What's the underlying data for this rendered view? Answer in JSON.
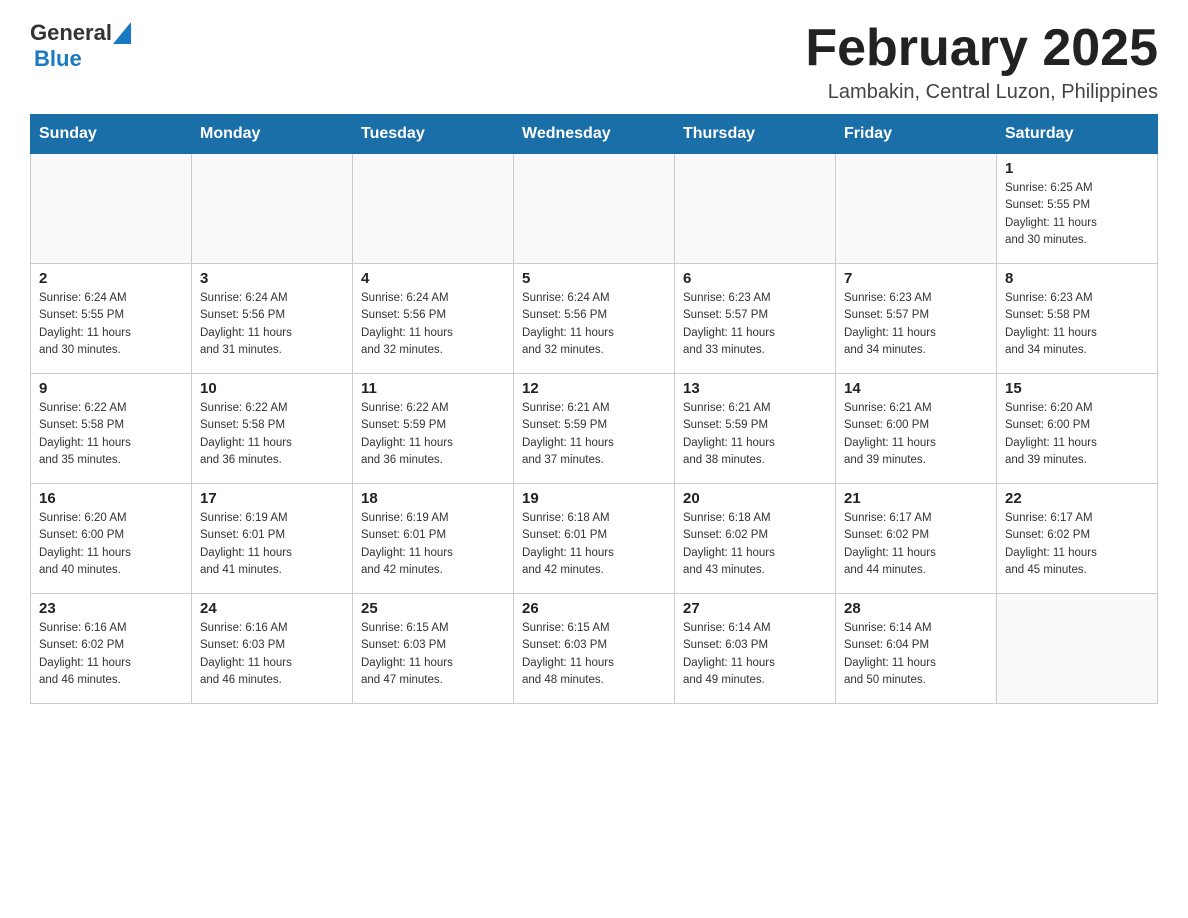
{
  "header": {
    "logo_general": "General",
    "logo_blue": "Blue",
    "month_title": "February 2025",
    "location": "Lambakin, Central Luzon, Philippines"
  },
  "calendar": {
    "days_of_week": [
      "Sunday",
      "Monday",
      "Tuesday",
      "Wednesday",
      "Thursday",
      "Friday",
      "Saturday"
    ],
    "weeks": [
      [
        {
          "day": "",
          "info": ""
        },
        {
          "day": "",
          "info": ""
        },
        {
          "day": "",
          "info": ""
        },
        {
          "day": "",
          "info": ""
        },
        {
          "day": "",
          "info": ""
        },
        {
          "day": "",
          "info": ""
        },
        {
          "day": "1",
          "info": "Sunrise: 6:25 AM\nSunset: 5:55 PM\nDaylight: 11 hours\nand 30 minutes."
        }
      ],
      [
        {
          "day": "2",
          "info": "Sunrise: 6:24 AM\nSunset: 5:55 PM\nDaylight: 11 hours\nand 30 minutes."
        },
        {
          "day": "3",
          "info": "Sunrise: 6:24 AM\nSunset: 5:56 PM\nDaylight: 11 hours\nand 31 minutes."
        },
        {
          "day": "4",
          "info": "Sunrise: 6:24 AM\nSunset: 5:56 PM\nDaylight: 11 hours\nand 32 minutes."
        },
        {
          "day": "5",
          "info": "Sunrise: 6:24 AM\nSunset: 5:56 PM\nDaylight: 11 hours\nand 32 minutes."
        },
        {
          "day": "6",
          "info": "Sunrise: 6:23 AM\nSunset: 5:57 PM\nDaylight: 11 hours\nand 33 minutes."
        },
        {
          "day": "7",
          "info": "Sunrise: 6:23 AM\nSunset: 5:57 PM\nDaylight: 11 hours\nand 34 minutes."
        },
        {
          "day": "8",
          "info": "Sunrise: 6:23 AM\nSunset: 5:58 PM\nDaylight: 11 hours\nand 34 minutes."
        }
      ],
      [
        {
          "day": "9",
          "info": "Sunrise: 6:22 AM\nSunset: 5:58 PM\nDaylight: 11 hours\nand 35 minutes."
        },
        {
          "day": "10",
          "info": "Sunrise: 6:22 AM\nSunset: 5:58 PM\nDaylight: 11 hours\nand 36 minutes."
        },
        {
          "day": "11",
          "info": "Sunrise: 6:22 AM\nSunset: 5:59 PM\nDaylight: 11 hours\nand 36 minutes."
        },
        {
          "day": "12",
          "info": "Sunrise: 6:21 AM\nSunset: 5:59 PM\nDaylight: 11 hours\nand 37 minutes."
        },
        {
          "day": "13",
          "info": "Sunrise: 6:21 AM\nSunset: 5:59 PM\nDaylight: 11 hours\nand 38 minutes."
        },
        {
          "day": "14",
          "info": "Sunrise: 6:21 AM\nSunset: 6:00 PM\nDaylight: 11 hours\nand 39 minutes."
        },
        {
          "day": "15",
          "info": "Sunrise: 6:20 AM\nSunset: 6:00 PM\nDaylight: 11 hours\nand 39 minutes."
        }
      ],
      [
        {
          "day": "16",
          "info": "Sunrise: 6:20 AM\nSunset: 6:00 PM\nDaylight: 11 hours\nand 40 minutes."
        },
        {
          "day": "17",
          "info": "Sunrise: 6:19 AM\nSunset: 6:01 PM\nDaylight: 11 hours\nand 41 minutes."
        },
        {
          "day": "18",
          "info": "Sunrise: 6:19 AM\nSunset: 6:01 PM\nDaylight: 11 hours\nand 42 minutes."
        },
        {
          "day": "19",
          "info": "Sunrise: 6:18 AM\nSunset: 6:01 PM\nDaylight: 11 hours\nand 42 minutes."
        },
        {
          "day": "20",
          "info": "Sunrise: 6:18 AM\nSunset: 6:02 PM\nDaylight: 11 hours\nand 43 minutes."
        },
        {
          "day": "21",
          "info": "Sunrise: 6:17 AM\nSunset: 6:02 PM\nDaylight: 11 hours\nand 44 minutes."
        },
        {
          "day": "22",
          "info": "Sunrise: 6:17 AM\nSunset: 6:02 PM\nDaylight: 11 hours\nand 45 minutes."
        }
      ],
      [
        {
          "day": "23",
          "info": "Sunrise: 6:16 AM\nSunset: 6:02 PM\nDaylight: 11 hours\nand 46 minutes."
        },
        {
          "day": "24",
          "info": "Sunrise: 6:16 AM\nSunset: 6:03 PM\nDaylight: 11 hours\nand 46 minutes."
        },
        {
          "day": "25",
          "info": "Sunrise: 6:15 AM\nSunset: 6:03 PM\nDaylight: 11 hours\nand 47 minutes."
        },
        {
          "day": "26",
          "info": "Sunrise: 6:15 AM\nSunset: 6:03 PM\nDaylight: 11 hours\nand 48 minutes."
        },
        {
          "day": "27",
          "info": "Sunrise: 6:14 AM\nSunset: 6:03 PM\nDaylight: 11 hours\nand 49 minutes."
        },
        {
          "day": "28",
          "info": "Sunrise: 6:14 AM\nSunset: 6:04 PM\nDaylight: 11 hours\nand 50 minutes."
        },
        {
          "day": "",
          "info": ""
        }
      ]
    ]
  }
}
